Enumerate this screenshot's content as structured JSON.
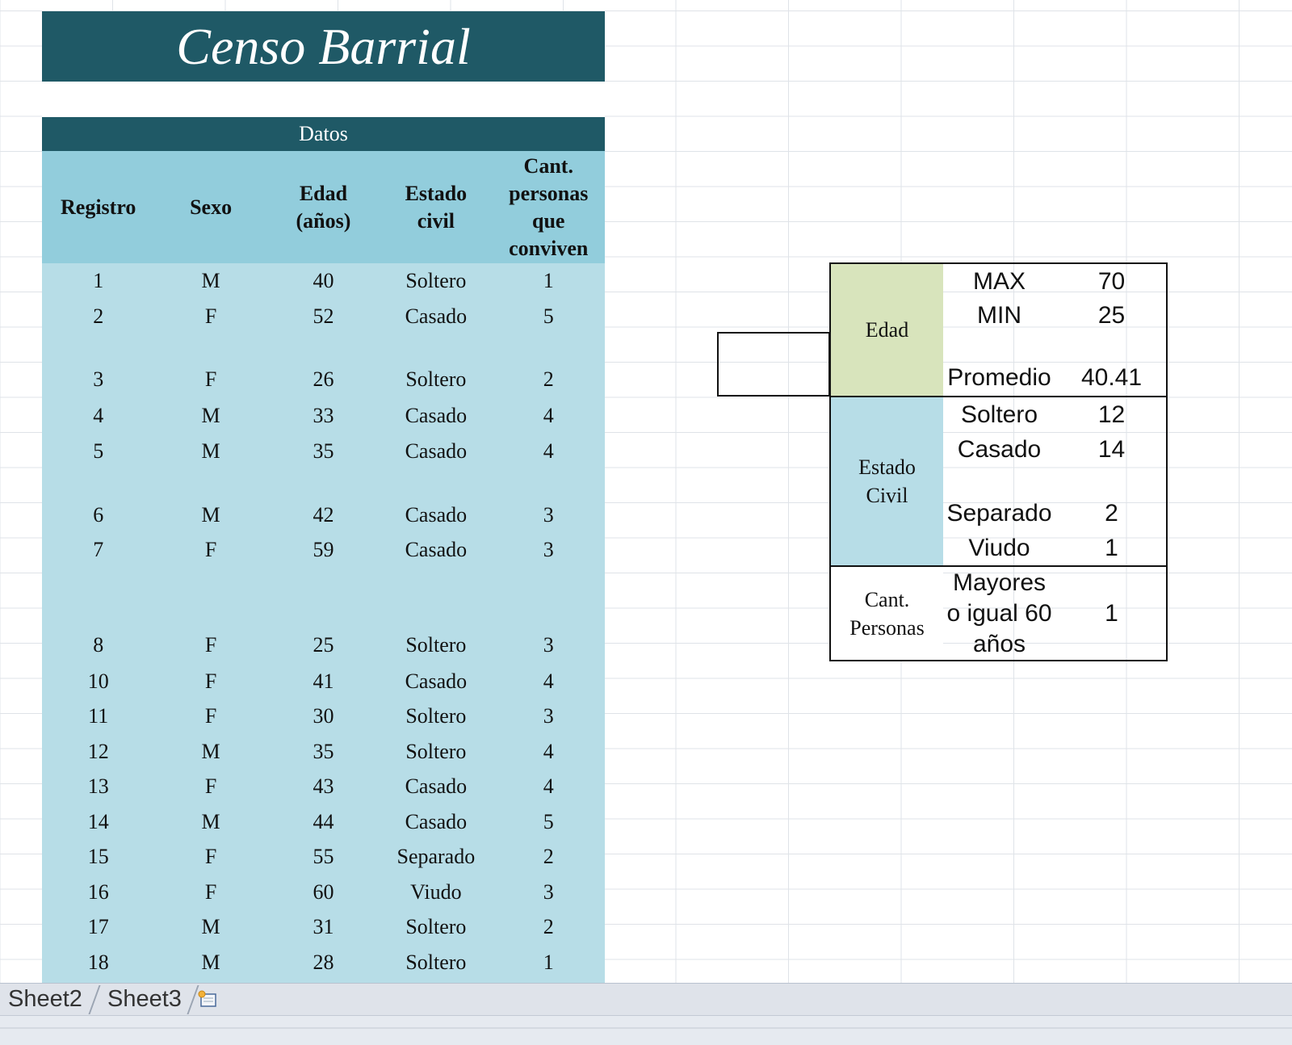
{
  "sheet": {
    "title": "Censo Barrial",
    "datos_header": "Datos",
    "columns": [
      [
        "Registro"
      ],
      [
        "Sexo"
      ],
      [
        "Edad",
        "(años)"
      ],
      [
        "Estado",
        "civil"
      ],
      [
        "Cant.",
        "personas",
        "que",
        "conviven"
      ]
    ],
    "rows": [
      [
        "1",
        "M",
        "40",
        "Soltero",
        "1"
      ],
      [
        "2",
        "F",
        "52",
        "Casado",
        "5"
      ],
      [
        "3",
        "F",
        "26",
        "Soltero",
        "2"
      ],
      [
        "4",
        "M",
        "33",
        "Casado",
        "4"
      ],
      [
        "5",
        "M",
        "35",
        "Casado",
        "4"
      ],
      [
        "6",
        "M",
        "42",
        "Casado",
        "3"
      ],
      [
        "7",
        "F",
        "59",
        "Casado",
        "3"
      ],
      [
        "8",
        "F",
        "25",
        "Soltero",
        "3"
      ],
      [
        "10",
        "F",
        "41",
        "Casado",
        "4"
      ],
      [
        "11",
        "F",
        "30",
        "Soltero",
        "3"
      ],
      [
        "12",
        "M",
        "35",
        "Soltero",
        "4"
      ],
      [
        "13",
        "F",
        "43",
        "Casado",
        "4"
      ],
      [
        "14",
        "M",
        "44",
        "Casado",
        "5"
      ],
      [
        "15",
        "F",
        "55",
        "Separado",
        "2"
      ],
      [
        "16",
        "F",
        "60",
        "Viudo",
        "3"
      ],
      [
        "17",
        "M",
        "31",
        "Soltero",
        "2"
      ],
      [
        "18",
        "M",
        "28",
        "Soltero",
        "1"
      ]
    ]
  },
  "summary": {
    "edad": {
      "label": "Edad",
      "max_label": "MAX",
      "max_value": "70",
      "min_label": "MIN",
      "min_value": "25",
      "avg_label": "Promedio",
      "avg_value": "40.41"
    },
    "estado_civil": {
      "label_line1": "Estado",
      "label_line2": "Civil",
      "items": [
        {
          "label": "Soltero",
          "value": "12"
        },
        {
          "label": "Casado",
          "value": "14"
        },
        {
          "label": "Separado",
          "value": "2"
        },
        {
          "label": "Viudo",
          "value": "1"
        }
      ]
    },
    "cant_personas": {
      "label_line1": "Cant.",
      "label_line2": "Personas",
      "criterion_line1": "Mayores",
      "criterion_line2": "o igual 60",
      "criterion_line3": "años",
      "value": "1"
    }
  },
  "tabs": [
    "Sheet2",
    "Sheet3"
  ],
  "colors": {
    "title_band": "#1f5966",
    "header_light": "#92cddc",
    "data_fill": "#b7dde7",
    "edad_fill": "#d8e4bc",
    "estado_fill": "#b7dde7"
  },
  "icons": {
    "new_sheet": "insert-worksheet-icon"
  }
}
